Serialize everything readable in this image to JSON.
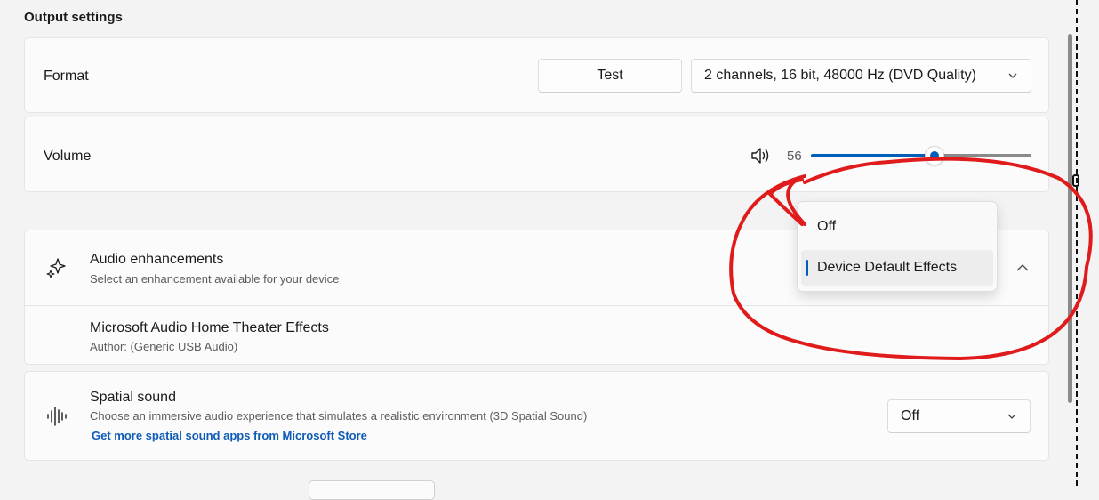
{
  "section": {
    "title": "Output settings"
  },
  "format": {
    "label": "Format",
    "test_button": "Test",
    "dropdown_value": "2 channels, 16 bit, 48000 Hz (DVD Quality)"
  },
  "volume": {
    "label": "Volume",
    "value": "56",
    "level": 0.56,
    "icon": "speaker-icon"
  },
  "enhancements": {
    "title": "Audio enhancements",
    "subtitle": "Select an enhancement available for your device",
    "icon": "sparkles-icon",
    "dropdown": {
      "options": [
        "Off",
        "Device Default Effects"
      ],
      "selected": "Device Default Effects"
    },
    "effect_name": "Microsoft Audio Home Theater Effects",
    "effect_author": "Author: (Generic USB Audio)"
  },
  "spatial": {
    "title": "Spatial sound",
    "subtitle": "Choose an immersive audio experience that simulates a realistic environment (3D Spatial Sound)",
    "link": "Get more spatial sound apps from Microsoft Store",
    "value": "Off",
    "icon": "waveform-icon"
  },
  "annotation": {
    "color": "#e01b1b"
  },
  "accent_color": "#005fb8"
}
